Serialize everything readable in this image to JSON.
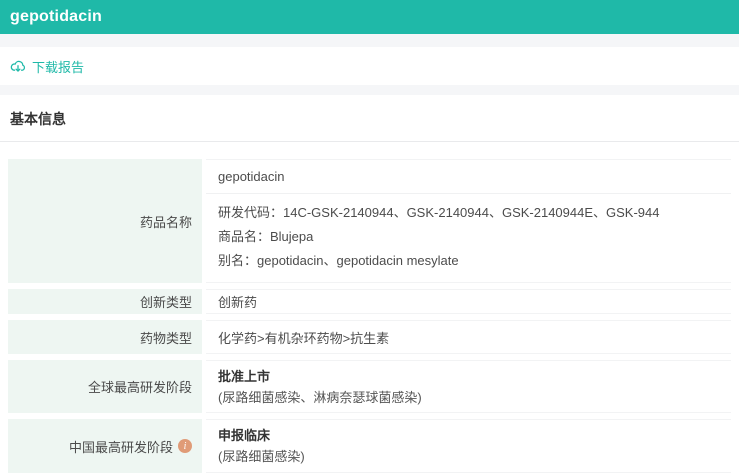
{
  "header": {
    "title": "gepotidacin"
  },
  "toolbar": {
    "download_label": "下载报告",
    "download_icon": "cloud-download-icon"
  },
  "section": {
    "title": "基本信息"
  },
  "colors": {
    "accent_teal": "#1fb9a8",
    "label_cell_bg": "#eef6f2",
    "strip_gray": "#f5f6f8",
    "info_icon_bg": "#e09b77"
  },
  "info_icon_glyph": "i",
  "table": {
    "rows": [
      {
        "label": "药品名称",
        "primary": "gepotidacin",
        "details": [
          "研发代码：14C-GSK-2140944、GSK-2140944、GSK-2140944E、GSK-944",
          "商品名：Blujepa",
          "别名：gepotidacin、gepotidacin mesylate"
        ]
      },
      {
        "label": "创新类型",
        "value": "创新药"
      },
      {
        "label": "药物类型",
        "value": "化学药>有机杂环药物>抗生素"
      },
      {
        "label": "全球最高研发阶段",
        "stage": "批准上市",
        "indications": "(尿路细菌感染、淋病奈瑟球菌感染)"
      },
      {
        "label": "中国最高研发阶段",
        "stage": "申报临床",
        "indications": "(尿路细菌感染)"
      }
    ]
  }
}
